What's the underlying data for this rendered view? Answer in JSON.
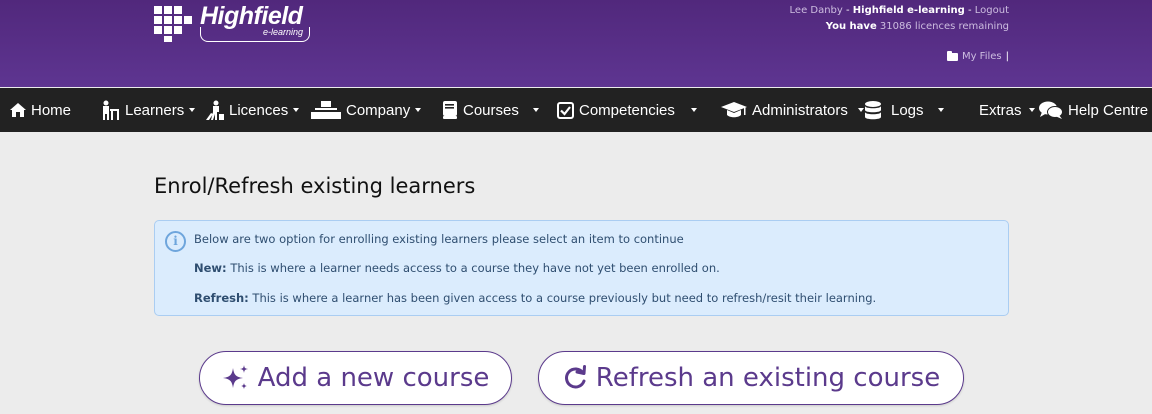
{
  "brand": {
    "name": "Highfield",
    "subtitle": "e-learning"
  },
  "user": {
    "name": "Lee Danby",
    "separator": " - ",
    "org": "Highfield e-learning",
    "logout": "Logout",
    "licences_prefix": "You have",
    "licences_count": "31086",
    "licences_suffix": "licences remaining",
    "my_files": "My Files",
    "my_files_sep": "|"
  },
  "nav": {
    "home": "Home",
    "learners": "Learners",
    "licences": "Licences",
    "company": "Company",
    "courses": "Courses",
    "competencies": "Competencies",
    "administrators": "Administrators",
    "logs": "Logs",
    "extras": "Extras",
    "help": "Help Centre"
  },
  "page": {
    "title": "Enrol/Refresh existing learners",
    "info_intro": "Below are two option for enrolling existing learners please select an item to continue",
    "new_label": "New:",
    "new_text": "This is where a learner needs access to a course they have not yet been enrolled on.",
    "refresh_label": "Refresh:",
    "refresh_text": "This is where a learner has been given access to a course previously but need to refresh/resit their learning.",
    "add_button": "Add a new course",
    "refresh_button": "Refresh an existing course"
  },
  "colors": {
    "header": "#5a3189",
    "nav": "#222222",
    "accent": "#5b3a8c",
    "info_bg": "#dbecfd"
  }
}
